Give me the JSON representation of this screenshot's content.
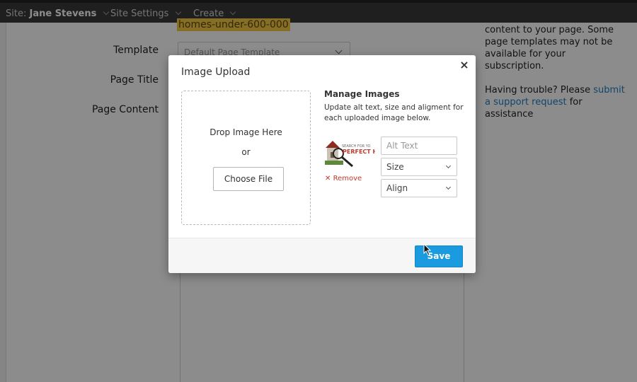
{
  "topbar": {
    "site_prefix": "Site:",
    "site_name": "Jane Stevens",
    "site_settings": "Site Settings",
    "create": "Create"
  },
  "page": {
    "slug": "homes-under-600-000",
    "template_label": "Template",
    "template_value": "Default Page Template",
    "page_title_label": "Page Title",
    "page_content_label": "Page Content"
  },
  "sidebar": {
    "line1": "content to your page. Some",
    "line2": "page templates may not be",
    "line3": "available for your subscription.",
    "trouble_prefix": "Having trouble? Please",
    "link_line1": "submit",
    "link_line2": "a support request",
    "trouble_suffix": "for",
    "trouble_last": "assistance"
  },
  "modal": {
    "title": "Image Upload",
    "close_glyph": "×",
    "drop_text": "Drop Image Here",
    "or_text": "or",
    "choose_file": "Choose File",
    "manage_title": "Manage Images",
    "manage_desc": "Update alt text, size and aligment for each uploaded image below.",
    "thumb_text1": "SEARCH FOR YO",
    "thumb_text2": "PERFECT H",
    "remove_glyph": "✕",
    "remove_label": "Remove",
    "alt_placeholder": "Alt Text",
    "size_value": "Size",
    "align_value": "Align",
    "save": "Save"
  },
  "colors": {
    "topbar": "#3a3a3a",
    "slug_highlight": "#f5c842",
    "link": "#1f7fc2",
    "save_button": "#1a9be0",
    "remove": "#c0392b"
  }
}
